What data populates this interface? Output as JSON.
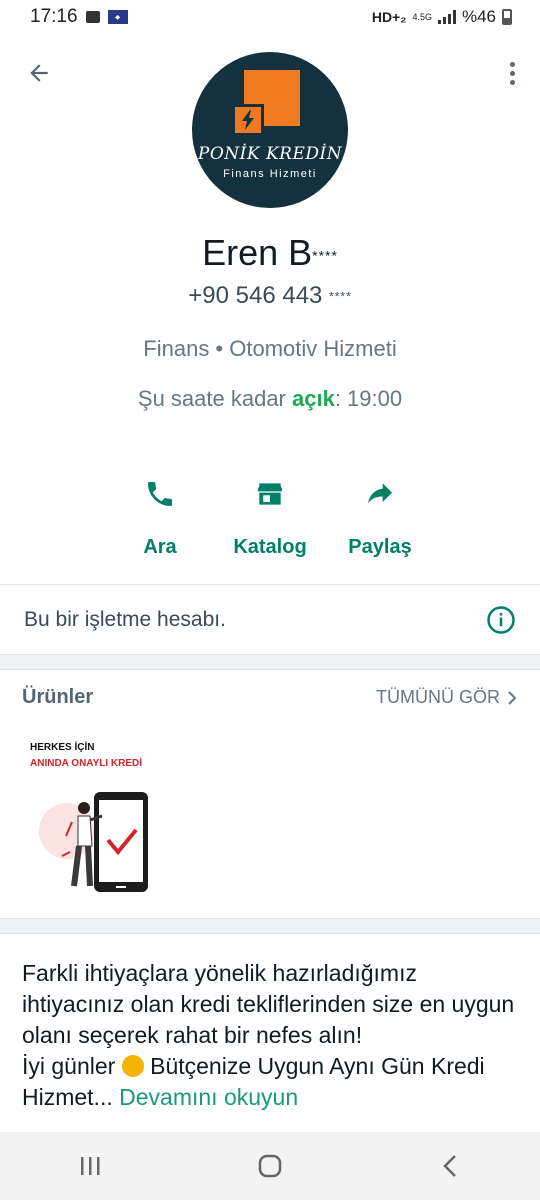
{
  "status_bar": {
    "time": "17:16",
    "network": "HD+₂",
    "net_gen": "4.5G",
    "battery": "%46"
  },
  "profile": {
    "logo_title": "PONİK KREDİN",
    "logo_subtitle": "Finans Hizmeti",
    "name": "Eren B",
    "name_mask": "****",
    "phone": "+90 546 443",
    "phone_mask": "****",
    "category": "Finans • Otomotiv Hizmeti",
    "hours_prefix": "Şu saate kadar",
    "hours_open": "açık",
    "hours_suffix": ": 19:00"
  },
  "actions": [
    {
      "label": "Ara",
      "icon": "phone-icon"
    },
    {
      "label": "Katalog",
      "icon": "storefront-icon"
    },
    {
      "label": "Paylaş",
      "icon": "share-icon"
    }
  ],
  "business_note": "Bu bir işletme hesabı.",
  "products": {
    "title": "Ürünler",
    "see_all": "TÜMÜNÜ GÖR",
    "items": [
      {
        "line1": "HERKES İÇİN",
        "line2": "ANINDA ONAYLI KREDİ"
      }
    ]
  },
  "description": {
    "p1": "Farkli ihtiyaçlara yönelik hazırladığımız ihtiyacınız olan kredi tekliflerinden size en uygun olanı seçerek rahat bir nefes alın!",
    "p2_start": "İyi günler",
    "p2_end": "Bütçenize Uygun Aynı Gün Kredi Hizmet...",
    "read_more": "Devamını okuyun"
  },
  "colors": {
    "accent": "#008069",
    "open": "#1fa855",
    "logo_bg": "#13313f",
    "logo_orange": "#f07a22"
  }
}
